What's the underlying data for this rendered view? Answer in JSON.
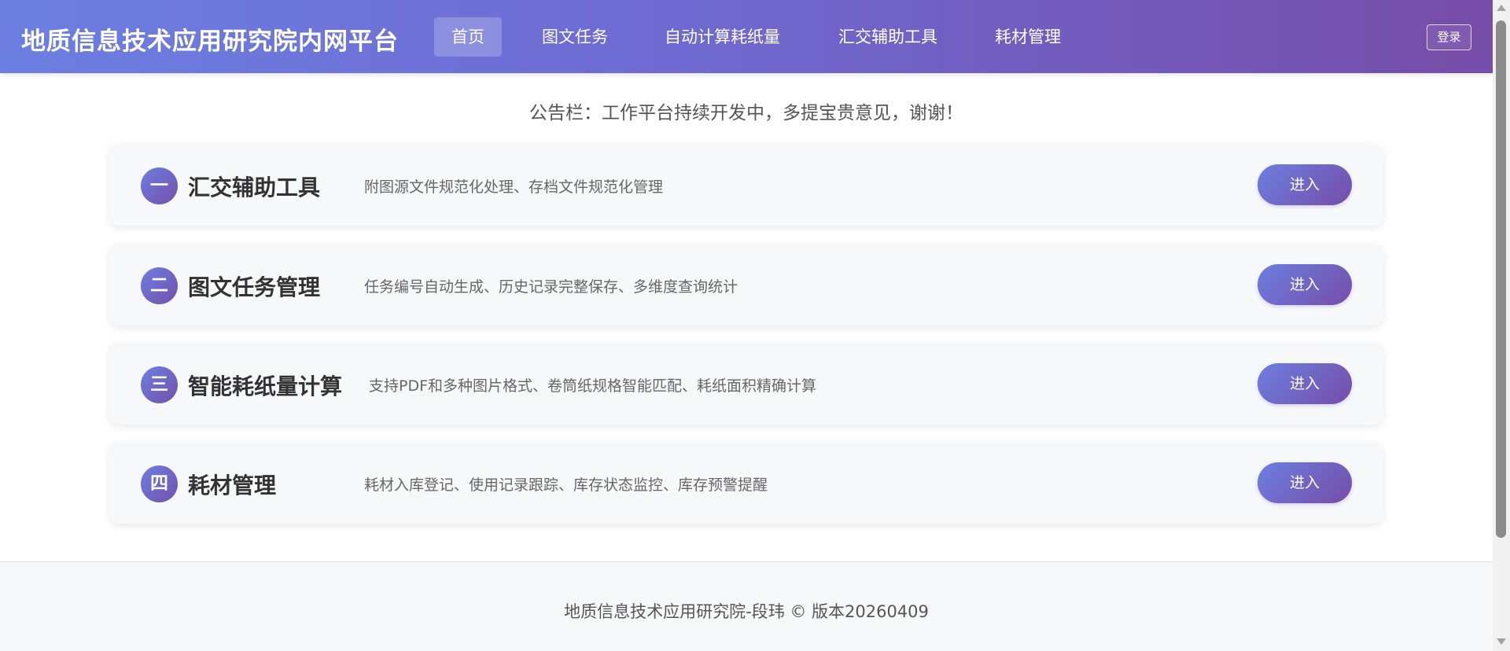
{
  "header": {
    "brand": "地质信息技术应用研究院内网平台",
    "nav": [
      {
        "label": "首页",
        "active": true
      },
      {
        "label": "图文任务",
        "active": false
      },
      {
        "label": "自动计算耗纸量",
        "active": false
      },
      {
        "label": "汇交辅助工具",
        "active": false
      },
      {
        "label": "耗材管理",
        "active": false
      }
    ],
    "login_label": "登录"
  },
  "notice": "公告栏：工作平台持续开发中，多提宝贵意见，谢谢！",
  "modules": [
    {
      "number": "一",
      "title": "汇交辅助工具",
      "desc": "附图源文件规范化处理、存档文件规范化管理",
      "button": "进入"
    },
    {
      "number": "二",
      "title": "图文任务管理",
      "desc": "任务编号自动生成、历史记录完整保存、多维度查询统计",
      "button": "进入"
    },
    {
      "number": "三",
      "title": "智能耗纸量计算",
      "desc": "支持PDF和多种图片格式、卷筒纸规格智能匹配、耗纸面积精确计算",
      "button": "进入"
    },
    {
      "number": "四",
      "title": "耗材管理",
      "desc": "耗材入库登记、使用记录跟踪、库存状态监控、库存预警提醒",
      "button": "进入"
    }
  ],
  "footer": {
    "text": "地质信息技术应用研究院-段玮 © 版本20260409"
  },
  "colors": {
    "header_gradient_start": "#6c7fe0",
    "header_gradient_end": "#764da8",
    "card_background": "#f7f8fa",
    "text_dark": "#333333"
  }
}
